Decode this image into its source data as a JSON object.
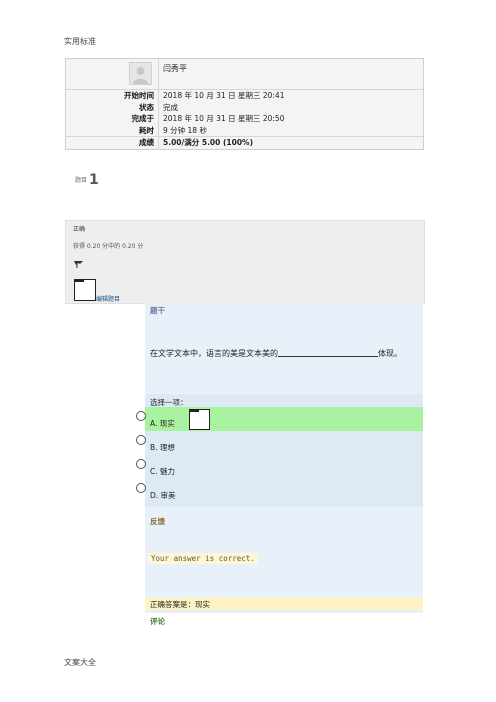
{
  "header_top": "实用标准",
  "footer": "文案大全",
  "summary": {
    "user_name": "闫秀平",
    "rows": [
      {
        "label": "开始时间",
        "value": "2018 年 10 月 31 日 星期三 20:41"
      },
      {
        "label": "状态",
        "value": "完成"
      },
      {
        "label": "完成于",
        "value": "2018 年 10 月 31 日 星期三 20:50"
      },
      {
        "label": "耗时",
        "value": "9 分钟 18 秒"
      }
    ],
    "grade_label": "成绩",
    "grade_value": "5.00/满分 5.00 (100%)"
  },
  "question": {
    "prefix": "题目",
    "number": "1",
    "status": "正确",
    "mark": "获得 0.20 分中的 0.20 分",
    "flag_icon": "flag-icon",
    "edit_label": "编辑题目",
    "stem_label": "题干",
    "text_before": "在文学文本中，语言的美是文本美的",
    "text_after": "体现。",
    "prompt": "选择一项：",
    "options": [
      {
        "text": "A. 现实",
        "correct": true
      },
      {
        "text": "B. 理想",
        "correct": false
      },
      {
        "text": "C. 魅力",
        "correct": false
      },
      {
        "text": "D. 审美",
        "correct": false
      }
    ],
    "feedback_label": "反馈",
    "feedback_text": "Your answer is correct.",
    "right_answer": "正确答案是：现实",
    "comment_label": "评论"
  },
  "colors": {
    "correct_bg": "#a9f2a0",
    "answer_bg": "#dde9f5",
    "info_bg": "#eeeeee",
    "rightanswer_bg": "#fff3c4"
  }
}
